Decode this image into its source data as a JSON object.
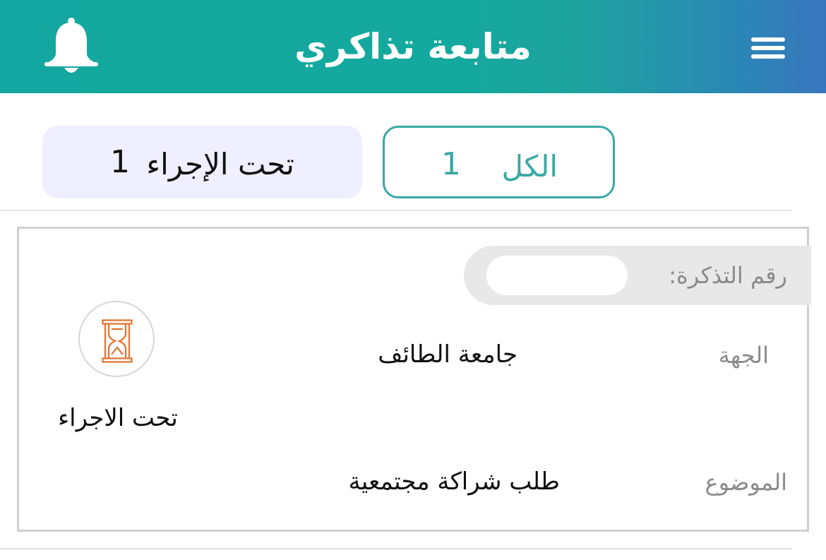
{
  "header": {
    "title": "متابعة تذاكري",
    "menu_icon": "hamburger-menu-icon",
    "bell_icon": "bell-icon"
  },
  "tabs": [
    {
      "label": "الكل",
      "count": "1",
      "active": true
    },
    {
      "label": "تحت الإجراء",
      "count": "1",
      "active": false
    }
  ],
  "ticket": {
    "number_label": "رقم التذكرة:",
    "entity_label": "الجهة",
    "entity_value": "جامعة الطائف",
    "subject_label": "الموضوع",
    "subject_value": "طلب شراكة مجتمعية",
    "status_text": "تحت الاجراء",
    "status_icon": "hourglass-icon"
  },
  "colors": {
    "header_start": "#14a79f",
    "header_end": "#3a76bd",
    "accent": "#3aa8a4",
    "tab_inactive_bg": "#efefff",
    "status_icon": "#e07a3c"
  }
}
